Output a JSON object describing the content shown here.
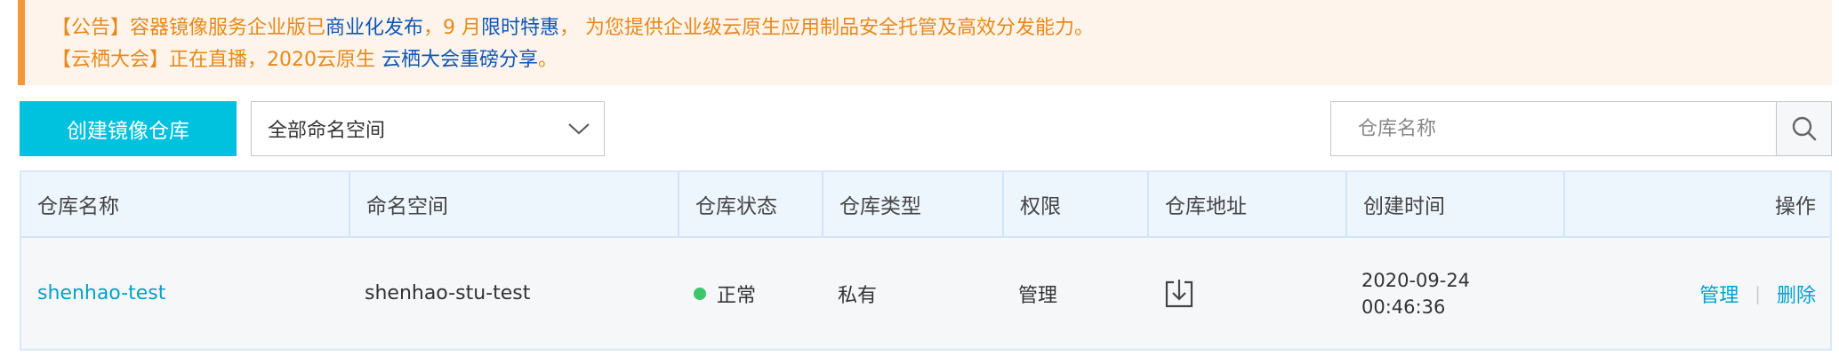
{
  "notice": {
    "line1": {
      "prefix": "【公告】容器镜像服务企业版已",
      "link1": "商业化发布",
      "middle": "，9 月",
      "link2": "限时特惠",
      "suffix": "， 为您提供企业级云原生应用制品安全托管及高效分发能力。"
    },
    "line2": {
      "prefix": "【云栖大会】正在直播，2020云原生 ",
      "link": "云栖大会重磅分享",
      "suffix": "。"
    }
  },
  "toolbar": {
    "create_label": "创建镜像仓库",
    "namespace_select_value": "全部命名空间",
    "search_placeholder": "仓库名称"
  },
  "table": {
    "headers": [
      "仓库名称",
      "命名空间",
      "仓库状态",
      "仓库类型",
      "权限",
      "仓库地址",
      "创建时间",
      "操作"
    ],
    "rows": [
      {
        "name": "shenhao-test",
        "namespace": "shenhao-stu-test",
        "status": "正常",
        "type": "私有",
        "permission": "管理",
        "address_icon": "download-icon",
        "created_date": "2020-09-24",
        "created_time": "00:46:36",
        "actions": {
          "manage": "管理",
          "separator": "|",
          "delete": "删除"
        }
      }
    ]
  },
  "colors": {
    "accent": "#00c1de",
    "link": "#00a3c9",
    "notice_text": "#e8891a",
    "notice_link": "#0d57b5",
    "status_ok": "#3dc76a"
  }
}
